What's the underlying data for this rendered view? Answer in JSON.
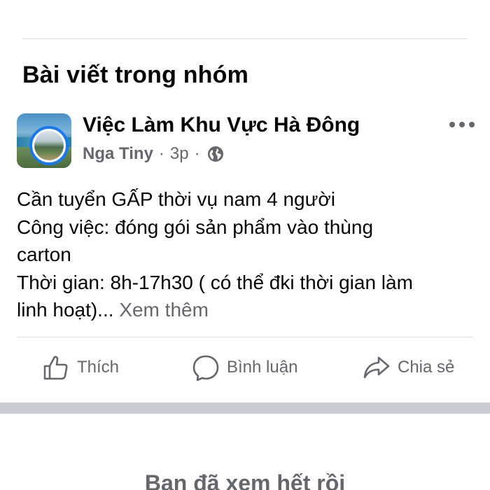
{
  "section": {
    "title": "Bài viết trong nhóm"
  },
  "post": {
    "group_name": "Việc Làm Khu Vực Hà Đông",
    "author": "Nga Tiny",
    "separator": "·",
    "time": "3p",
    "privacy_icon": "globe-icon",
    "more_icon": "more-options-icon",
    "body_lines": [
      "Cần tuyển GẤP thời vụ nam 4 người",
      "Công việc: đóng gói sản phẩm vào thùng",
      "carton",
      "Thời gian: 8h-17h30 ( có thể đki thời gian làm",
      "linh hoạt)..."
    ],
    "see_more": "Xem thêm"
  },
  "actions": {
    "like": {
      "label": "Thích",
      "icon": "thumbs-up-icon"
    },
    "comment": {
      "label": "Bình luận",
      "icon": "comment-icon"
    },
    "share": {
      "label": "Chia sẻ",
      "icon": "share-icon"
    }
  },
  "footer": {
    "end_text": "Bạn đã xem hết rồi"
  },
  "colors": {
    "accent": "#1877f2",
    "secondary_text": "#65676b",
    "divider": "#dadde1",
    "gap_band": "#c9ccd1"
  }
}
